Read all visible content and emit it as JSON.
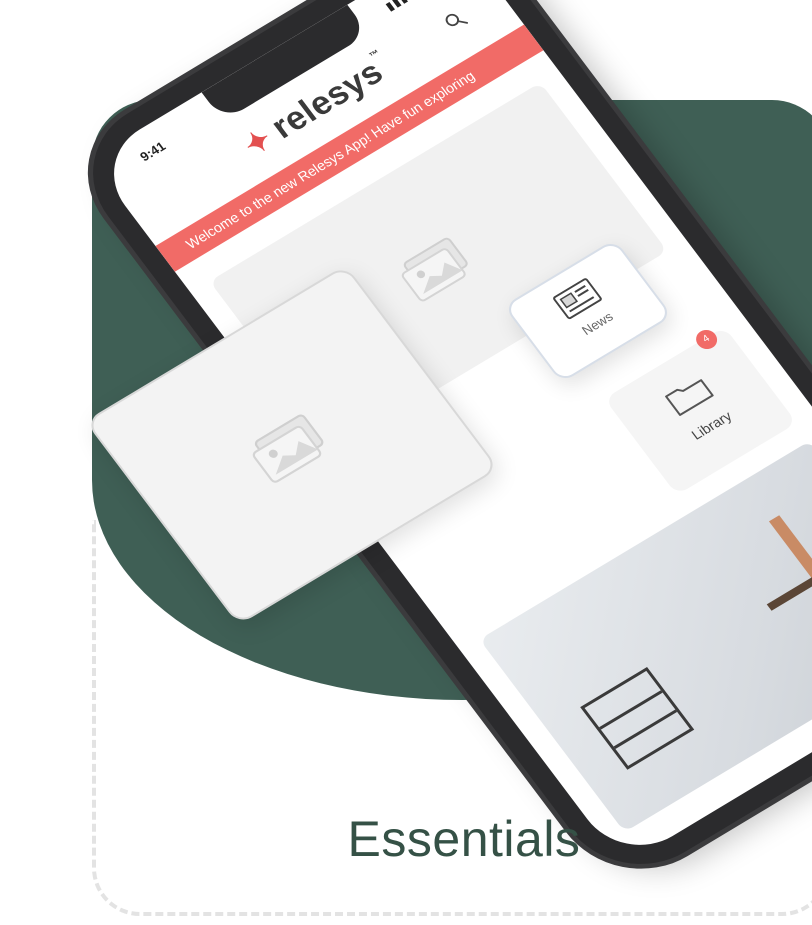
{
  "phone": {
    "time": "9:41",
    "status_icons": "▮▮▮ ◉ ▬",
    "logo_text": "relesys",
    "tm": "™",
    "banner_text": "Welcome to the new Relesys App! Have fun exploring",
    "news_label": "News",
    "library_label": "Library",
    "badge_count": "4"
  },
  "footer": {
    "title": "Essentials"
  },
  "colors": {
    "green": "#3f5f55",
    "banner": "#f16b67",
    "text": "#355146"
  },
  "icons": {
    "search": "search-icon",
    "placeholder": "image-placeholder-icon",
    "news": "news-icon",
    "folder": "folder-icon"
  }
}
